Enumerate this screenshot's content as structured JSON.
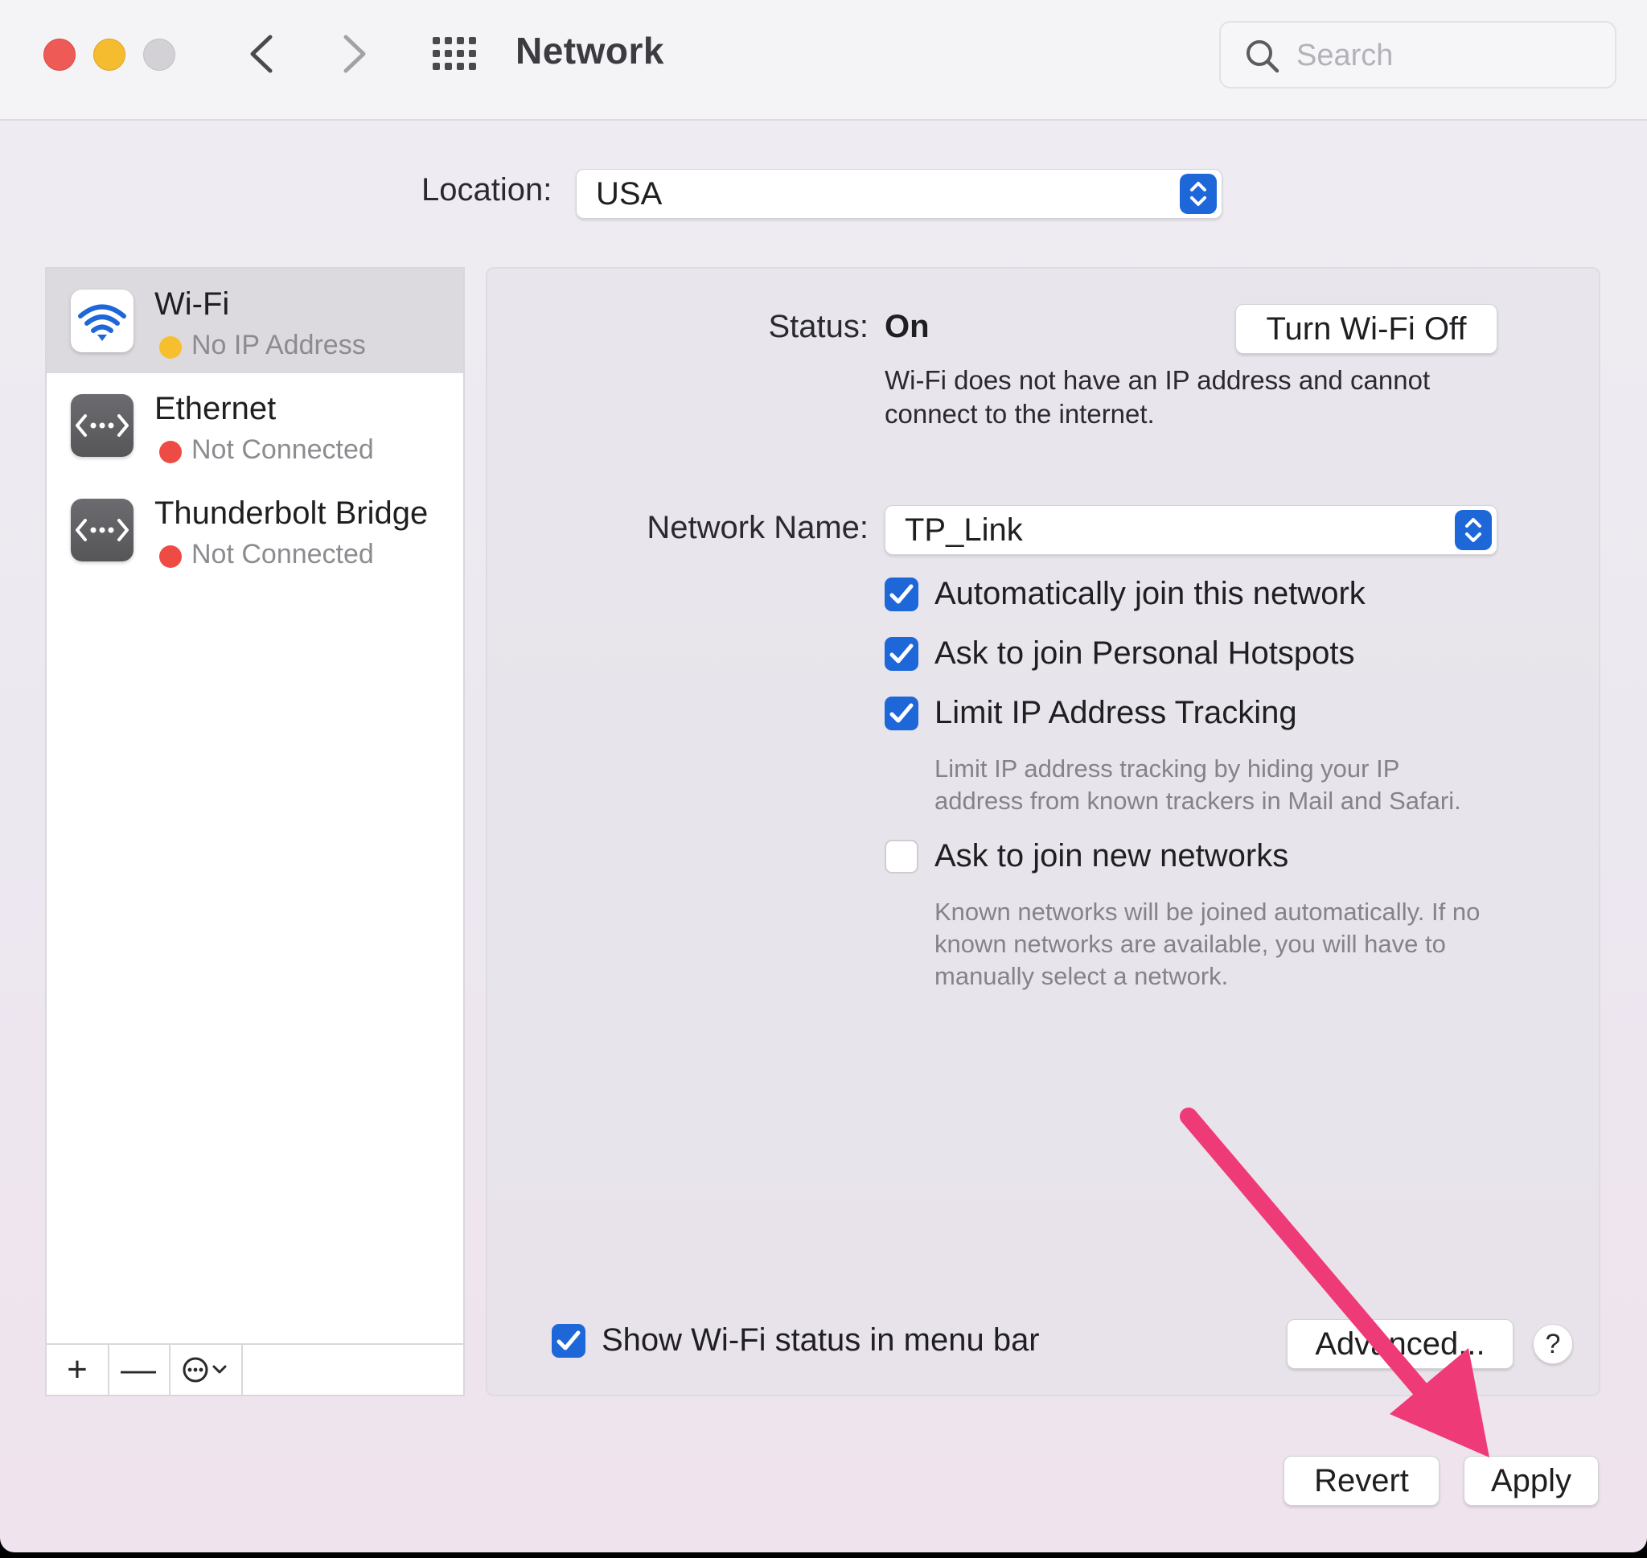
{
  "window": {
    "title": "Network",
    "search_placeholder": "Search"
  },
  "location": {
    "label": "Location:",
    "value": "USA"
  },
  "services": [
    {
      "name": "Wi-Fi",
      "status": "No IP Address",
      "status_color": "#f7bf2e",
      "icon": "wifi-icon"
    },
    {
      "name": "Ethernet",
      "status": "Not Connected",
      "status_color": "#ee4b44",
      "icon": "ethernet-icon"
    },
    {
      "name": "Thunderbolt Bridge",
      "status": "Not Connected",
      "status_color": "#ee4b44",
      "icon": "thunderbolt-bridge-icon"
    }
  ],
  "sidebar_tools": {
    "add": "+",
    "remove": "—"
  },
  "detail": {
    "status_label": "Status:",
    "status_value": "On",
    "turn_off_button": "Turn Wi-Fi Off",
    "status_desc_line1": "Wi-Fi does not have an IP address and cannot",
    "status_desc_line2": "connect to the internet.",
    "network_name_label": "Network Name:",
    "network_name_value": "TP_Link",
    "options": [
      {
        "label": "Automatically join this network",
        "checked": true
      },
      {
        "label": "Ask to join Personal Hotspots",
        "checked": true
      },
      {
        "label": "Limit IP Address Tracking",
        "checked": true
      },
      {
        "label": "Ask to join new networks",
        "checked": false
      }
    ],
    "limit_desc_line1": "Limit IP address tracking by hiding your IP",
    "limit_desc_line2": "address from known trackers in Mail and Safari.",
    "known_desc_line1": "Known networks will be joined automatically. If no",
    "known_desc_line2": "known networks are available, you will have to",
    "known_desc_line3": "manually select a network.",
    "show_status_label": "Show Wi-Fi status in menu bar",
    "show_status_checked": true,
    "advanced_button": "Advanced...",
    "help_button": "?"
  },
  "footer": {
    "revert_button": "Revert",
    "apply_button": "Apply"
  },
  "colors": {
    "accent": "#1e67d9",
    "annotation_arrow": "#ef3a78"
  }
}
